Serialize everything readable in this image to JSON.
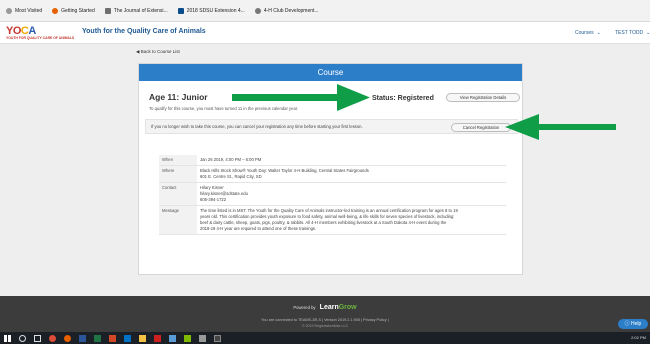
{
  "bookmarks": [
    {
      "label": "Most Visited",
      "icon": "star-icon",
      "color": "#888888"
    },
    {
      "label": "Getting Started",
      "icon": "firefox-icon",
      "color": "#e66000"
    },
    {
      "label": "The Journal of Extensi...",
      "icon": "page-icon",
      "color": "#6f6f6f"
    },
    {
      "label": "2018 SDSU Extension 4...",
      "icon": "page-icon",
      "color": "#0a4d8c"
    },
    {
      "label": "4-H Club Development...",
      "icon": "globe-icon",
      "color": "#777777"
    }
  ],
  "header": {
    "logo_text": [
      "YO",
      "C",
      "A"
    ],
    "logo_sub": "YOUTH FOR QUALITY CARE OF ANIMALS",
    "site_title": "Youth for the Quality Care of Animals",
    "nav_courses": "Courses",
    "nav_user": "TEST TODD"
  },
  "back_link": "◀ Back to Course List",
  "card": {
    "header": "Course",
    "title": "Age 11: Junior",
    "qualification": "To qualify for this course, you must have turned 11 in the previous calendar year.",
    "status": "Status: Registered",
    "view_button": "View Registration Details",
    "cancel_text": "If you no longer wish to take this course, you can cancel your registration any time before starting your first lesson.",
    "cancel_button": "Cancel Registration"
  },
  "details": {
    "when_label": "When",
    "when_value": "Jan 26 2019, 4:00 PM – 6:00 PM",
    "where_label": "Where",
    "where_lines": [
      "Black Hills Stock Show® Youth Day: Walter Taylor 4-H Building, Central States Fairgrounds",
      "601 E. Centre St., Rapid City, SD"
    ],
    "contact_label": "Contact",
    "contact_lines": [
      "Hilary Kisner",
      "hilary.kisner@sdstate.edu",
      "605-394-1722"
    ],
    "message_label": "Message",
    "message_lines": [
      "The time listed is in MST. The Youth for the Quality Care of Animals instructor-led training is an annual certification program for ages 8 to 19",
      "years old. This certification provides youth exposure to food safety, animal well-being, & life skills for seven species of livestock, including:",
      "beef & dairy cattle, sheep, goats, pigs, poultry, & rabbits. All 4-H members exhibiting livestock at a South Dakota 4-H event during the",
      "2018-19 4-H year are required to attend one of these trainings."
    ]
  },
  "footer": {
    "powered_by": "Powered by",
    "brand_a": "Learn",
    "brand_b": "Grow",
    "line1": "You are connected to TEAMS-3R-S  |  Version 2019.2.1.905  |  Privacy Policy  |",
    "line2": "© 2019 RegistrationMax LLC"
  },
  "help": "ⓘ Help",
  "taskbar": {
    "icons": [
      "windows-icon",
      "search-icon",
      "task-view-icon",
      "chrome-icon",
      "firefox-icon",
      "word-icon",
      "excel-icon",
      "powerpoint-icon",
      "outlook-icon",
      "folder-icon",
      "acrobat-icon",
      "app-icon",
      "app-icon",
      "app-icon",
      "app-icon"
    ],
    "time": "2:02 PM"
  },
  "colors": {
    "accent": "#2d7ec9",
    "arrow": "#0f9d48",
    "title": "#1f5a93"
  }
}
